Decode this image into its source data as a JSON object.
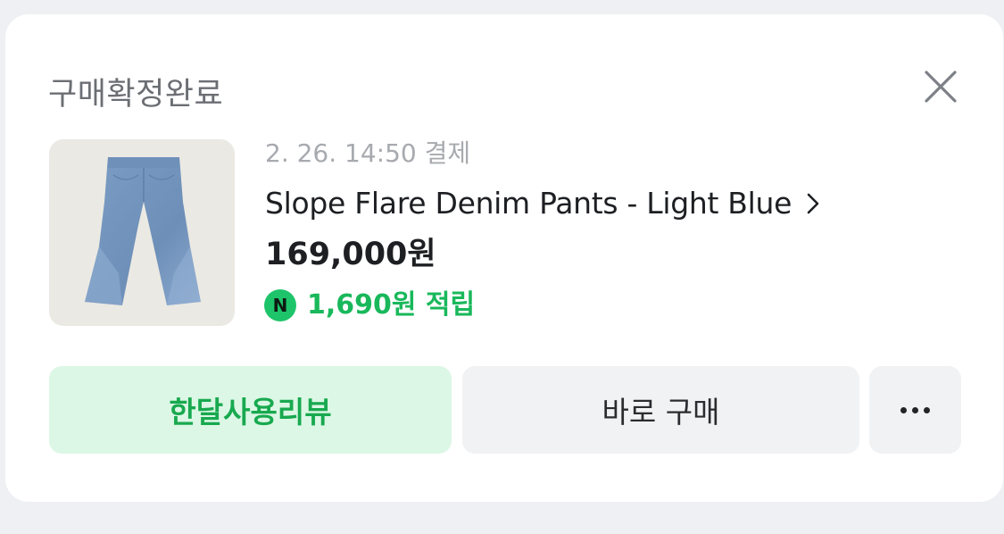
{
  "order": {
    "status_title": "구매확정완료",
    "payment_datetime": "2. 26. 14:50 결제",
    "product_name": "Slope Flare Denim Pants - Light Blue",
    "price": "169,000원",
    "points_icon_label": "N",
    "points": "1,690원 적립"
  },
  "actions": {
    "review_label": "한달사용리뷰",
    "buy_again_label": "바로 구매"
  },
  "icons": {
    "close": "close-icon",
    "chevron": "chevron-right-icon",
    "points": "naver-pay-points-icon",
    "more": "more-dots-icon"
  },
  "colors": {
    "accent_green": "#19b85b",
    "review_button_bg": "#dcf7e5",
    "neutral_button_bg": "#f1f2f4",
    "page_bg": "#eef0f3"
  }
}
